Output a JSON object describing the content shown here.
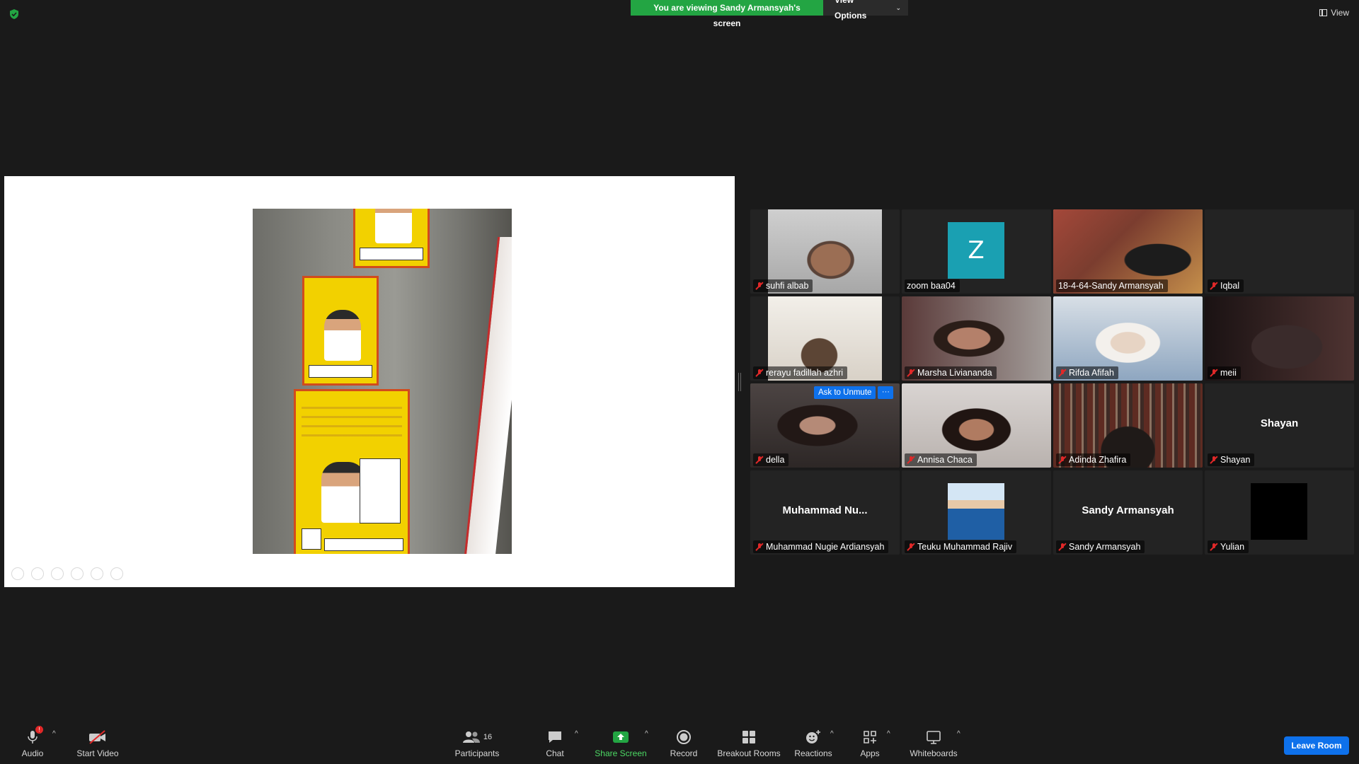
{
  "banner": {
    "viewing_text": "You are viewing Sandy Armansyah's screen",
    "view_options_label": "View Options"
  },
  "top_right": {
    "view_label": "View"
  },
  "shared_screen": {
    "sharer": "Sandy Armansyah"
  },
  "gallery": {
    "tiles": [
      {
        "name": "suhfi albab",
        "type": "video",
        "muted": true
      },
      {
        "name": "zoom baa04",
        "type": "avatar",
        "avatar_letter": "Z",
        "muted": false
      },
      {
        "name": "18-4-64-Sandy Armansyah",
        "type": "video",
        "muted": false,
        "active_speaker": true
      },
      {
        "name": "Iqbal",
        "type": "blank",
        "muted": true
      },
      {
        "name": "rerayu fadillah azhri",
        "type": "video",
        "muted": true
      },
      {
        "name": "Marsha Liviananda",
        "type": "video",
        "muted": true
      },
      {
        "name": "Rifda Afifah",
        "type": "video",
        "muted": true
      },
      {
        "name": "meii",
        "type": "video",
        "muted": true
      },
      {
        "name": "della",
        "type": "video",
        "muted": true
      },
      {
        "name": "Annisa Chaca",
        "type": "video",
        "muted": true
      },
      {
        "name": "Adinda Zhafira",
        "type": "video",
        "muted": true
      },
      {
        "name": "Shayan",
        "type": "text",
        "center_name": "Shayan",
        "muted": true
      },
      {
        "name": "Muhammad Nugie Ardiansyah",
        "type": "text",
        "center_name": "Muhammad  Nu...",
        "muted": true
      },
      {
        "name": "Teuku Muhammad Rajiv",
        "type": "photo",
        "muted": true
      },
      {
        "name": "Sandy Armansyah",
        "type": "text",
        "center_name": "Sandy Armansyah",
        "muted": true
      },
      {
        "name": "Yulian",
        "type": "black",
        "muted": true
      }
    ],
    "hover_actions": {
      "ask_to_unmute": "Ask to Unmute",
      "more": "···"
    }
  },
  "toolbar": {
    "audio": "Audio",
    "start_video": "Start Video",
    "participants": "Participants",
    "participants_count": "16",
    "chat": "Chat",
    "share_screen": "Share Screen",
    "record": "Record",
    "breakout_rooms": "Breakout Rooms",
    "reactions": "Reactions",
    "apps": "Apps",
    "whiteboards": "Whiteboards",
    "leave_room": "Leave Room"
  },
  "colors": {
    "banner_green": "#23a543",
    "accent_blue": "#0e71eb",
    "active_speaker": "#e2e57a",
    "muted_red": "#e02828",
    "background": "#1a1a1a"
  }
}
